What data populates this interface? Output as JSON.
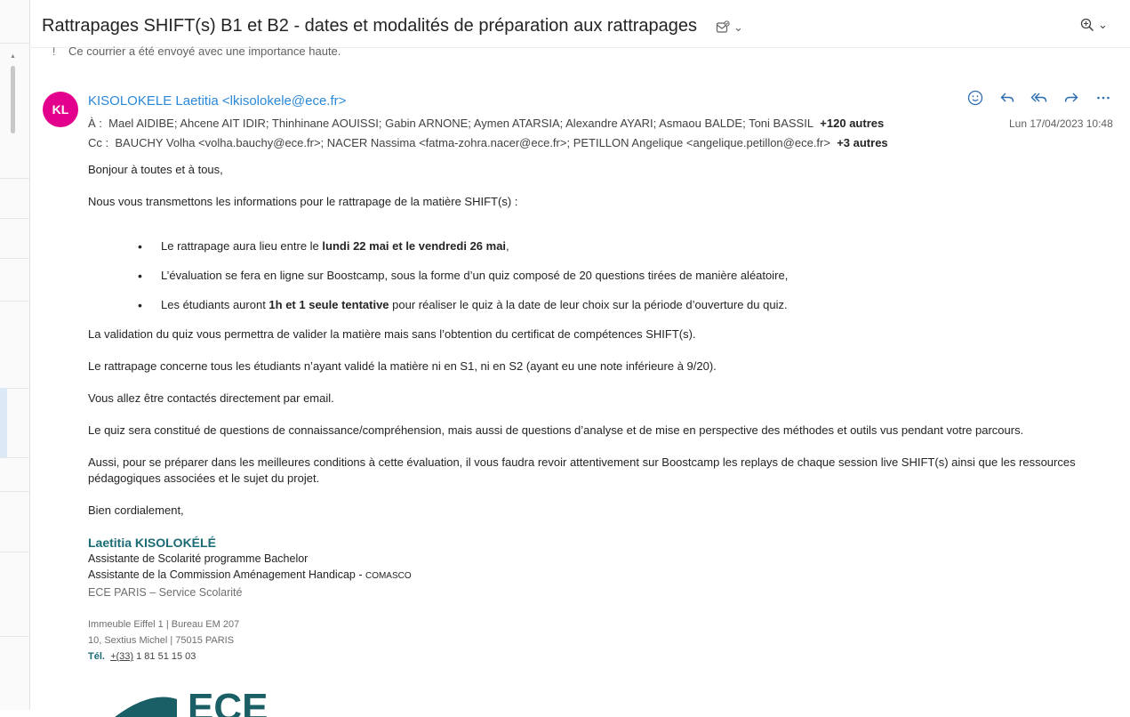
{
  "subject": "Rattrapages SHIFT(s) B1 et B2 - dates et modalités de préparation aux rattrapages",
  "importance_notice": "Ce courrier a été envoyé avec une importance haute.",
  "sender": {
    "initials": "KL",
    "display": "KISOLOKELE Laetitia <lkisolokele@ece.fr>",
    "avatar_color": "#e3008c"
  },
  "to": {
    "label": "À :",
    "names": "Mael AIDIBE;  Ahcene AIT IDIR;  Thinhinane AOUISSI;  Gabin ARNONE;  Aymen ATARSIA;  Alexandre AYARI;  Asmaou BALDE;  Toni BASSIL",
    "more": "+120 autres"
  },
  "cc": {
    "label": "Cc :",
    "names": "BAUCHY Volha <volha.bauchy@ece.fr>;  NACER Nassima <fatma-zohra.nacer@ece.fr>;  PETILLON Angelique <angelique.petillon@ece.fr>",
    "more": "+3 autres"
  },
  "date": "Lun 17/04/2023 10:48",
  "body": {
    "greeting": "Bonjour à toutes et à tous,",
    "intro": "Nous vous transmettons les informations pour le rattrapage de la matière SHIFT(s) :",
    "bullet1_pre": "Le rattrapage aura lieu entre le ",
    "bullet1_bold": "lundi 22 mai et le vendredi 26 mai",
    "bullet1_post": ",",
    "bullet2": "L’évaluation se fera en ligne sur Boostcamp, sous la forme d’un quiz composé de 20 questions tirées de manière aléatoire,",
    "bullet3_pre": "Les étudiants auront ",
    "bullet3_bold": "1h et 1 seule tentative",
    "bullet3_post": " pour réaliser le quiz à la date de leur choix sur la période d’ouverture du quiz.",
    "p1": "La validation du quiz vous permettra de valider la matière mais sans l’obtention du certificat de compétences SHIFT(s).",
    "p2": "Le rattrapage concerne tous les étudiants n’ayant validé la matière ni en S1, ni en S2 (ayant eu une note inférieure à 9/20).",
    "p3": "Vous allez être contactés directement par email.",
    "p4": "Le quiz sera constitué de questions de connaissance/compréhension, mais aussi de questions d’analyse et de mise en perspective des méthodes et outils vus pendant votre parcours.",
    "p5": "Aussi, pour se préparer dans les meilleures conditions à cette évaluation, il vous faudra revoir attentivement sur Boostcamp les replays de chaque session live SHIFT(s) ainsi que les ressources pédagogiques associées et le sujet du projet.",
    "closing": "Bien cordialement,"
  },
  "signature": {
    "name": "Laetitia KISOLOKÉLÉ",
    "role1": "Assistante de Scolarité programme Bachelor",
    "role2": "Assistante de la Commission Aménagement Handicap - ",
    "role2_small": "COMASCO",
    "org": "ECE PARIS – Service Scolarité",
    "address1": "Immeuble Eiffel 1 | Bureau EM 207",
    "address2": "10, Sextius Michel  | 75015 PARIS",
    "tel_label": "Tél.",
    "tel_prefix": "+(33)",
    "tel_number": " 1 81 51 15 03",
    "logo_text": "ECE"
  },
  "icons": {
    "subject_action": "mail-check-icon",
    "zoom": "zoom-icon",
    "emoji": "emoji-icon",
    "reply": "reply-icon",
    "reply_all": "reply-all-icon",
    "forward": "forward-icon",
    "more": "more-icon",
    "importance": "high-importance-icon"
  }
}
